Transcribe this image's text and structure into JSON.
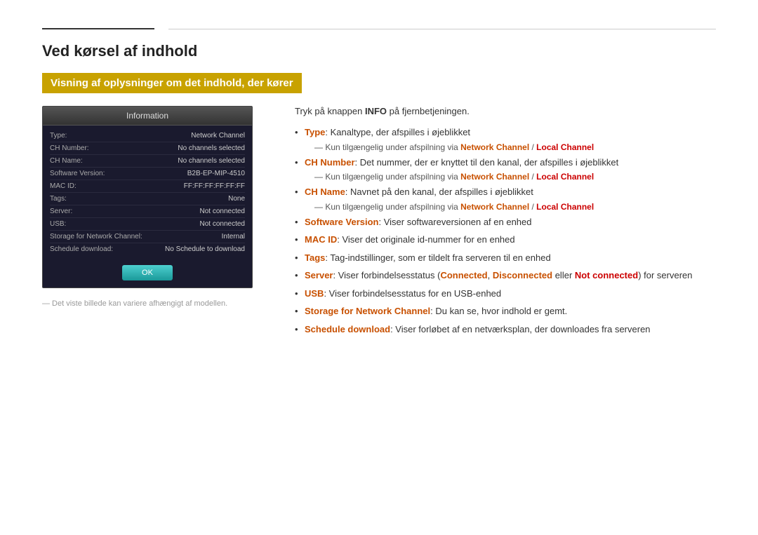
{
  "topRule": {},
  "pageTitle": "Ved kørsel af indhold",
  "highlightedSubtitle": "Visning af oplysninger om det indhold, der kører",
  "infoBox": {
    "header": "Information",
    "rows": [
      {
        "label": "Type:",
        "value": "Network Channel"
      },
      {
        "label": "CH Number:",
        "value": "No channels selected"
      },
      {
        "label": "CH Name:",
        "value": "No channels selected"
      },
      {
        "label": "Software Version:",
        "value": "B2B-EP-MIP-4510"
      },
      {
        "label": "MAC ID:",
        "value": "FF:FF:FF:FF:FF:FF"
      },
      {
        "label": "Tags:",
        "value": "None"
      },
      {
        "label": "Server:",
        "value": "Not connected"
      },
      {
        "label": "USB:",
        "value": "Not connected"
      },
      {
        "label": "Storage for Network Channel:",
        "value": "Internal"
      },
      {
        "label": "Schedule download:",
        "value": "No Schedule to download"
      }
    ],
    "okButton": "OK"
  },
  "footerNote": "― Det viste billede kan variere afhængigt af modellen.",
  "rightCol": {
    "introText": "Tryk på knappen ",
    "introBold": "INFO",
    "introTextAfter": " på fjernbetjeningen.",
    "bullets": [
      {
        "bold": "Type",
        "text": ": Kanaltype, der afspilles i øjeblikket",
        "subnote": "Kun tilgængelig under afspilning via ",
        "subnoteLink1": "Network Channel",
        "subnoteSlash": " / ",
        "subnoteLink2": "Local Channel"
      },
      {
        "bold": "CH Number",
        "text": ": Det nummer, der er knyttet til den kanal, der afspilles i øjeblikket",
        "subnote": "Kun tilgængelig under afspilning via ",
        "subnoteLink1": "Network Channel",
        "subnoteSlash": " / ",
        "subnoteLink2": "Local Channel"
      },
      {
        "bold": "CH Name",
        "text": ": Navnet på den kanal, der afspilles i øjeblikket",
        "subnote": "Kun tilgængelig under afspilning via ",
        "subnoteLink1": "Network Channel",
        "subnoteSlash": " / ",
        "subnoteLink2": "Local Channel"
      },
      {
        "bold": "Software Version",
        "text": ": Viser softwareversionen af en enhed"
      },
      {
        "bold": "MAC ID",
        "text": ": Viser det originale id-nummer for en enhed"
      },
      {
        "bold": "Tags",
        "text": ": Tag-indstillinger, som er tildelt fra serveren til en enhed"
      },
      {
        "bold": "Server",
        "text": ": Viser forbindelsesstatus (",
        "boldPart1": "Connected",
        "textMid": ", ",
        "boldPart2": "Disconnected",
        "textMid2": " eller ",
        "boldPart3": "Not connected",
        "textEnd": ") for serveren"
      },
      {
        "bold": "USB",
        "text": ": Viser forbindelsesstatus for en USB-enhed"
      },
      {
        "bold": "Storage for Network Channel",
        "text": ": Du kan se, hvor indhold er gemt."
      },
      {
        "bold": "Schedule download",
        "text": ": Viser forløbet af en netværksplan, der downloades fra serveren"
      }
    ]
  }
}
